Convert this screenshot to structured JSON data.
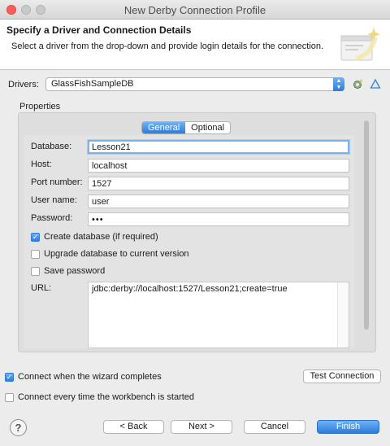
{
  "window": {
    "title": "New Derby Connection Profile"
  },
  "header": {
    "title": "Specify a Driver and Connection Details",
    "description": "Select a driver from the drop-down and provide login details for the connection."
  },
  "drivers": {
    "label": "Drivers:",
    "selected": "GlassFishSampleDB"
  },
  "properties": {
    "label": "Properties",
    "tabs": [
      {
        "label": "General",
        "active": true
      },
      {
        "label": "Optional",
        "active": false
      }
    ],
    "fields": {
      "database": {
        "label": "Database:",
        "value": "Lesson21"
      },
      "host": {
        "label": "Host:",
        "value": "localhost"
      },
      "port": {
        "label": "Port number:",
        "value": "1527"
      },
      "user": {
        "label": "User name:",
        "value": "user"
      },
      "password": {
        "label": "Password:",
        "value": "•••"
      }
    },
    "checkboxes": {
      "create_database": {
        "label": "Create database (if required)",
        "checked": true
      },
      "upgrade_database": {
        "label": "Upgrade database to current version",
        "checked": false
      },
      "save_password": {
        "label": "Save password",
        "checked": false
      }
    },
    "url": {
      "label": "URL:",
      "value": "jdbc:derby://localhost:1527/Lesson21;create=true"
    }
  },
  "options": {
    "connect_when_complete": {
      "label": "Connect when the wizard completes",
      "checked": true
    },
    "connect_every_time": {
      "label": "Connect every time the workbench is started",
      "checked": false
    },
    "test_connection_label": "Test Connection"
  },
  "footer": {
    "help": "?",
    "back": "< Back",
    "next": "Next >",
    "cancel": "Cancel",
    "finish": "Finish"
  },
  "icons": {
    "new_driver": "new-driver-icon",
    "edit_driver": "edit-driver-icon",
    "help": "help-icon",
    "wizard_banner": "wizard-banner-icon"
  },
  "colors": {
    "accent": "#3b8af0",
    "close": "#fc5f57"
  }
}
